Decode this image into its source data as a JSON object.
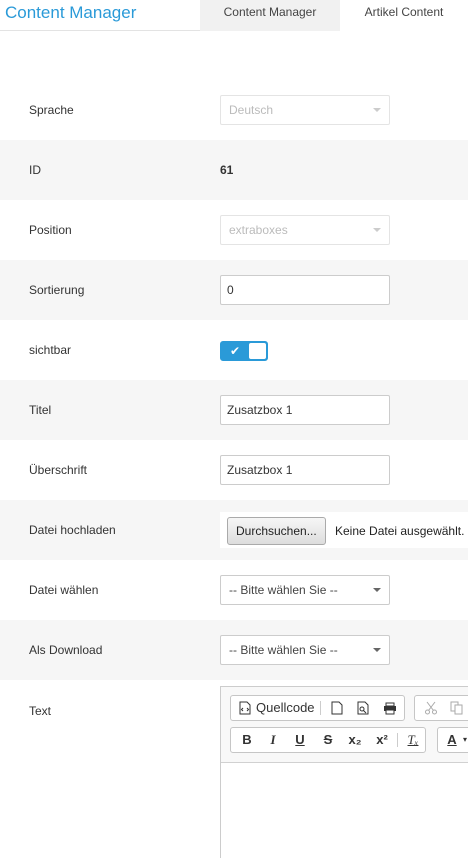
{
  "header": {
    "app_title": "Content Manager",
    "tabs": [
      {
        "label": "Content Manager"
      },
      {
        "label": "Artikel Content"
      }
    ]
  },
  "form": {
    "sprache": {
      "label": "Sprache",
      "value": "Deutsch"
    },
    "id": {
      "label": "ID",
      "value": "61"
    },
    "position": {
      "label": "Position",
      "value": "extraboxes"
    },
    "sortierung": {
      "label": "Sortierung",
      "value": "0"
    },
    "sichtbar": {
      "label": "sichtbar",
      "checked": true
    },
    "titel": {
      "label": "Titel",
      "value": "Zusatzbox 1"
    },
    "ueberschrift": {
      "label": "Überschrift",
      "value": "Zusatzbox 1"
    },
    "datei_hochladen": {
      "label": "Datei hochladen",
      "button": "Durchsuchen...",
      "status": "Keine Datei ausgewählt."
    },
    "datei_waehlen": {
      "label": "Datei wählen",
      "value": "-- Bitte wählen Sie --"
    },
    "als_download": {
      "label": "Als Download",
      "value": "-- Bitte wählen Sie --"
    },
    "text": {
      "label": "Text"
    }
  },
  "editor": {
    "source_label": "Quellcode",
    "bold": "B",
    "italic": "I",
    "underline": "U",
    "strike": "S",
    "subscript": "x₂",
    "superscript": "x²",
    "remove_format": "Tₓ",
    "text_color": "A"
  },
  "colors": {
    "accent": "#2a9ad8",
    "row_alt": "#f6f6f6"
  }
}
